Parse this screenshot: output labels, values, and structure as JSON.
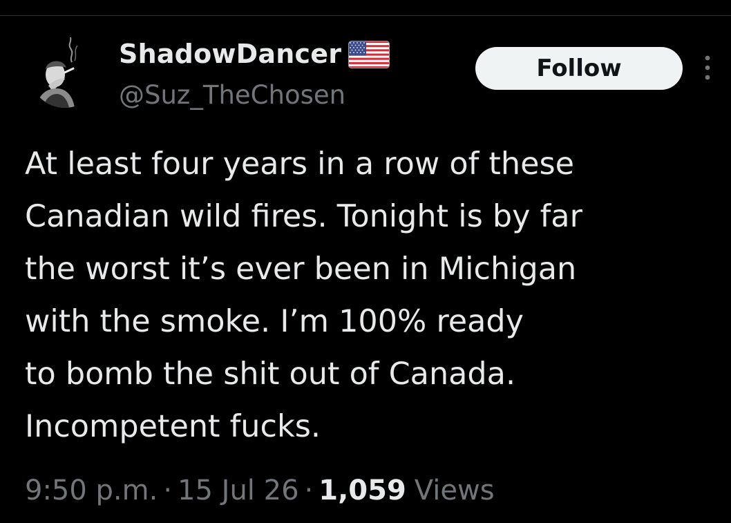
{
  "author": {
    "display_name": "ShadowDancer",
    "handle": "@Suz_TheChosen",
    "avatar_icon": "avatar-smoking-figure",
    "flag_icon": "us-flag-emoji"
  },
  "actions": {
    "follow_label": "Follow",
    "more_icon": "more-vertical-icon"
  },
  "tweet": {
    "text": "At least four years in a row of these\nCanadian wild fires. Tonight is by far\nthe worst it’s ever been in Michigan\nwith the smoke. I’m 100% ready\nto bomb the shit out of Canada.\nIncompetent fucks."
  },
  "meta": {
    "time": "9:50 p.m.",
    "separator": "·",
    "date": "15 Jul 26",
    "views_count": "1,059",
    "views_label": "Views"
  },
  "colors": {
    "background": "#000000",
    "primary_text": "#e7e9ea",
    "secondary_text": "#71767b",
    "follow_bg": "#eff3f4",
    "follow_text": "#0f1419",
    "divider": "#2f3336"
  }
}
